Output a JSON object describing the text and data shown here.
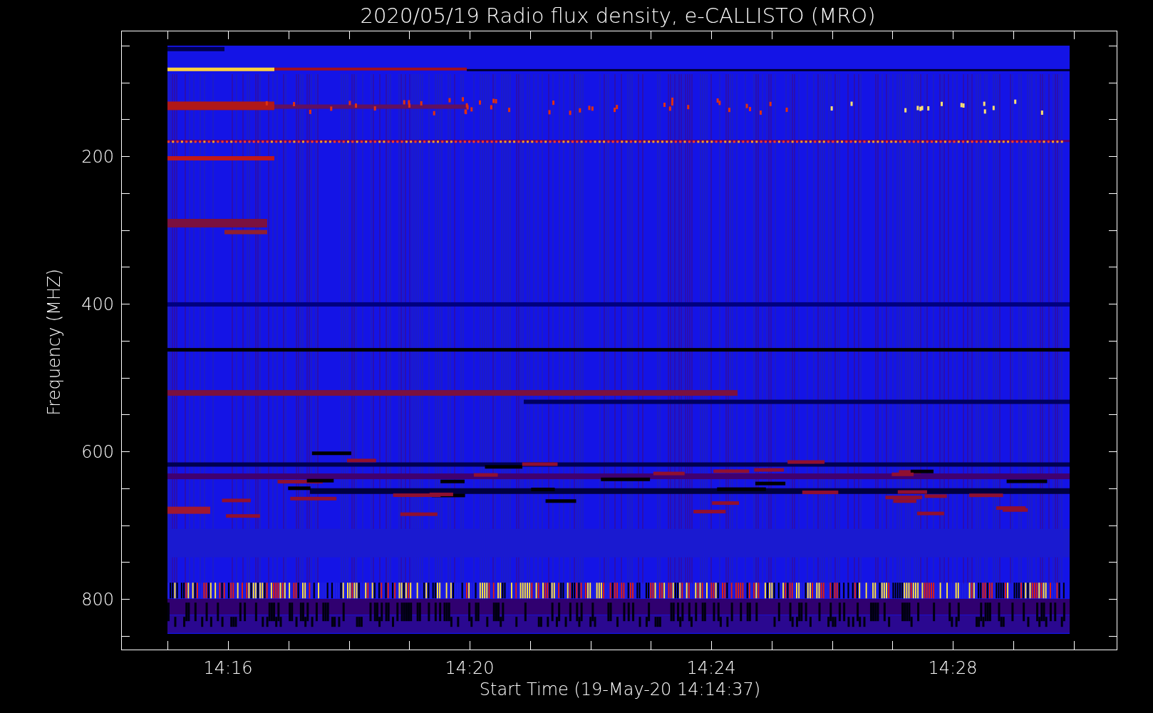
{
  "title": "2020/05/19  Radio flux density, e-CALLISTO (MRO)",
  "y_axis": {
    "label": "Frequency (MHZ)",
    "ticks": [
      "200",
      "400",
      "600",
      "800"
    ]
  },
  "x_axis": {
    "label": "Start Time (19-May-20 14:14:37)",
    "ticks": [
      "14:16",
      "14:20",
      "14:24",
      "14:28"
    ]
  }
}
